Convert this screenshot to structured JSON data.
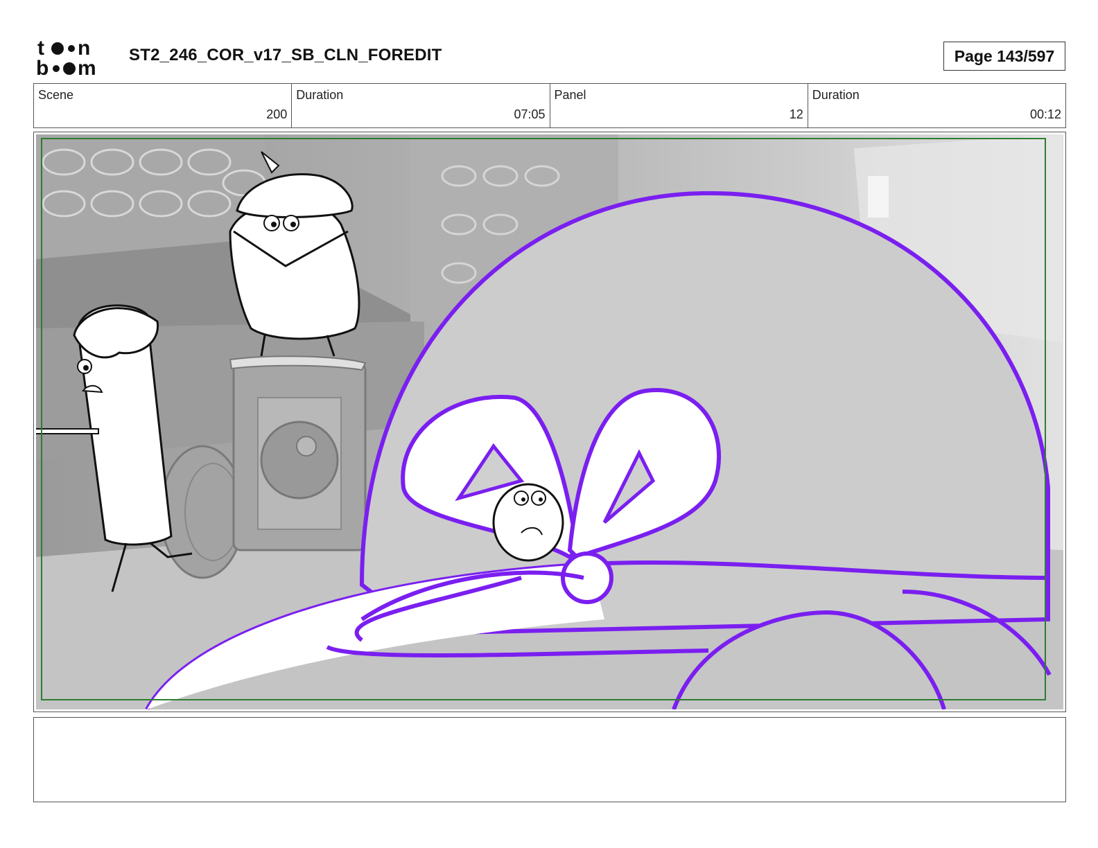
{
  "header": {
    "logo_text": "toon boom",
    "title": "ST2_246_COR_v17_SB_CLN_FOREDIT",
    "page_label": "Page 143/597"
  },
  "info": [
    {
      "label": "Scene",
      "value": "200"
    },
    {
      "label": "Duration",
      "value": "07:05"
    },
    {
      "label": "Panel",
      "value": "12"
    },
    {
      "label": "Duration",
      "value": "00:12"
    }
  ],
  "panel": {
    "frame_color": "#2e7d32",
    "outline_color": "#7a1ff0",
    "illustration_icon": "storyboard-sketch"
  },
  "notes": {
    "text": ""
  }
}
